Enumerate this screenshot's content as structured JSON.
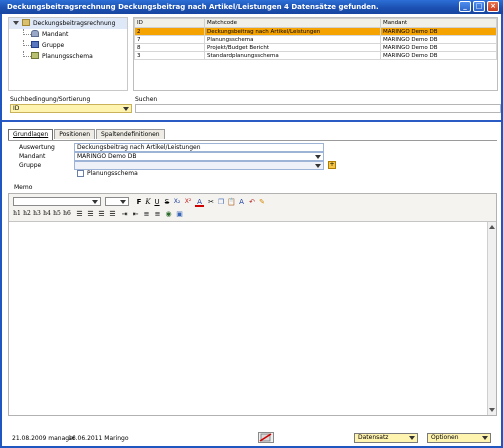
{
  "window": {
    "title": "Deckungsbeitragsrechnung Deckungsbeitrag nach Artikel/Leistungen  4 Datensätze gefunden."
  },
  "tree": {
    "root": "Deckungsbeitragsrechnung",
    "children": [
      "Mandant",
      "Gruppe",
      "Planungsschema"
    ]
  },
  "list": {
    "columns": [
      "ID",
      "Matchcode",
      "Mandant"
    ],
    "rows": [
      {
        "id": "2",
        "matchcode": "Deckungsbeitrag nach Artikel/Leistungen",
        "mandant": "MARINGO Demo DB",
        "selected": true
      },
      {
        "id": "7",
        "matchcode": "Planungsschema",
        "mandant": "MARINGO Demo DB",
        "selected": false
      },
      {
        "id": "8",
        "matchcode": "Projekt/Budget Bericht",
        "mandant": "MARINGO Demo DB",
        "selected": false
      },
      {
        "id": "3",
        "matchcode": "Standardplanungsschema",
        "mandant": "MARINGO Demo DB",
        "selected": false
      }
    ]
  },
  "search": {
    "condition_label": "Suchbedingung/Sortierung",
    "condition_value": "ID",
    "search_label": "Suchen",
    "search_value": ""
  },
  "tabs": [
    "Grundlagen",
    "Positionen",
    "Spaltendefinitionen"
  ],
  "form": {
    "auswertung_label": "Auswertung",
    "auswertung_value": "Deckungsbeitrag nach Artikel/Leistungen",
    "mandant_label": "Mandant",
    "mandant_value": "MARINGO Demo DB",
    "gruppe_label": "Gruppe",
    "gruppe_value": "",
    "planungsschema_label": "Planungsschema",
    "memo_label": "Memo"
  },
  "editor": {
    "headings": [
      "h1",
      "h2",
      "h3",
      "h4",
      "h5",
      "h6"
    ]
  },
  "status": {
    "created": "21.08.2009 manager",
    "modified": "16.06.2011 Maringo",
    "datensatz_label": "Datensatz",
    "optionen_label": "Optionen"
  },
  "colors": {
    "title_bar": "#1b4fb0",
    "selection": "#f5a300",
    "accent_yellow": "#fff3b0"
  }
}
